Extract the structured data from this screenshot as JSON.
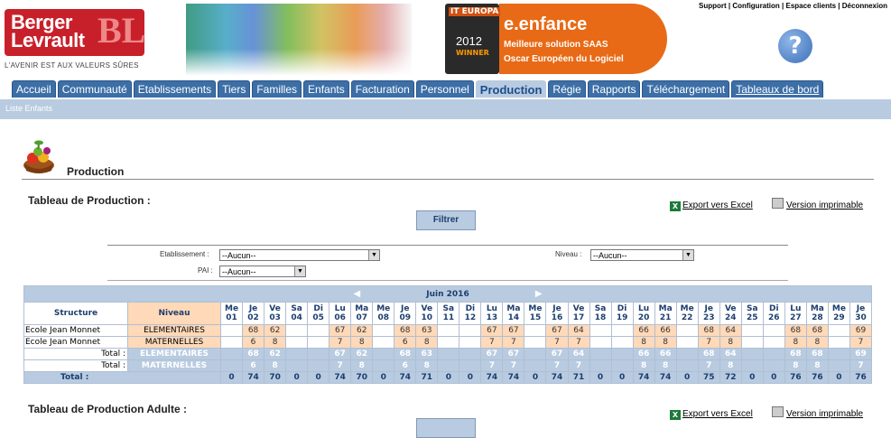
{
  "header": {
    "logo_line1": "Berger",
    "logo_line2": "Levrault",
    "logo_mark": "BL",
    "tagline": "L'AVENIR EST AUX VALEURS SÛRES",
    "award": {
      "badge": "IT EUROPA",
      "year": "2012",
      "winner": "WINNER",
      "title": "e.enfance",
      "line1": "Meilleure solution SAAS",
      "line2": "Oscar Européen du Logiciel"
    },
    "top_links": [
      "Support",
      "Configuration",
      "Espace clients",
      "Déconnexion"
    ],
    "help_glyph": "?"
  },
  "tabs": [
    {
      "label": "Accueil"
    },
    {
      "label": "Communauté"
    },
    {
      "label": "Etablissements"
    },
    {
      "label": "Tiers"
    },
    {
      "label": "Familles"
    },
    {
      "label": "Enfants"
    },
    {
      "label": "Facturation"
    },
    {
      "label": "Personnel"
    },
    {
      "label": "Production",
      "active": true
    },
    {
      "label": "Régie"
    },
    {
      "label": "Rapports"
    },
    {
      "label": "Téléchargement"
    },
    {
      "label": "Tableaux de bord"
    }
  ],
  "subnav": {
    "label": "Liste Enfants"
  },
  "page": {
    "title": "Production",
    "section_title": "Tableau de Production :",
    "section2_title": "Tableau de Production Adulte :",
    "export_excel": "Export vers Excel",
    "print_version": "Version imprimable",
    "filter_button": "Filtrer"
  },
  "filters": {
    "etablissement_label": "Etablissement :",
    "etablissement_value": "--Aucun--",
    "niveau_label": "Niveau :",
    "niveau_value": "--Aucun--",
    "pai_label": "PAI :",
    "pai_value": "--Aucun--"
  },
  "grid": {
    "month": "Juin 2016",
    "col_structure": "Structure",
    "col_niveau": "Niveau",
    "days": [
      [
        "Me",
        "01"
      ],
      [
        "Je",
        "02"
      ],
      [
        "Ve",
        "03"
      ],
      [
        "Sa",
        "04"
      ],
      [
        "Di",
        "05"
      ],
      [
        "Lu",
        "06"
      ],
      [
        "Ma",
        "07"
      ],
      [
        "Me",
        "08"
      ],
      [
        "Je",
        "09"
      ],
      [
        "Ve",
        "10"
      ],
      [
        "Sa",
        "11"
      ],
      [
        "Di",
        "12"
      ],
      [
        "Lu",
        "13"
      ],
      [
        "Ma",
        "14"
      ],
      [
        "Me",
        "15"
      ],
      [
        "Je",
        "16"
      ],
      [
        "Ve",
        "17"
      ],
      [
        "Sa",
        "18"
      ],
      [
        "Di",
        "19"
      ],
      [
        "Lu",
        "20"
      ],
      [
        "Ma",
        "21"
      ],
      [
        "Me",
        "22"
      ],
      [
        "Je",
        "23"
      ],
      [
        "Ve",
        "24"
      ],
      [
        "Sa",
        "25"
      ],
      [
        "Di",
        "26"
      ],
      [
        "Lu",
        "27"
      ],
      [
        "Ma",
        "28"
      ],
      [
        "Me",
        "29"
      ],
      [
        "Je",
        "30"
      ]
    ],
    "rows": [
      {
        "structure": "Ecole Jean Monnet",
        "niveau": "ELEMENTAIRES",
        "values": [
          "",
          "68",
          "62",
          "",
          "",
          "67",
          "62",
          "",
          "68",
          "63",
          "",
          "",
          "67",
          "67",
          "",
          "67",
          "64",
          "",
          "",
          "66",
          "66",
          "",
          "68",
          "64",
          "",
          "",
          "68",
          "68",
          "",
          "69"
        ]
      },
      {
        "structure": "Ecole Jean Monnet",
        "niveau": "MATERNELLES",
        "values": [
          "",
          "6",
          "8",
          "",
          "",
          "7",
          "8",
          "",
          "6",
          "8",
          "",
          "",
          "7",
          "7",
          "",
          "7",
          "7",
          "",
          "",
          "8",
          "8",
          "",
          "7",
          "8",
          "",
          "",
          "8",
          "8",
          "",
          "7"
        ]
      }
    ],
    "totals": [
      {
        "label": "Total :",
        "niveau": "ELEMENTAIRES",
        "values": [
          "",
          "68",
          "62",
          "",
          "",
          "67",
          "62",
          "",
          "68",
          "63",
          "",
          "",
          "67",
          "67",
          "",
          "67",
          "64",
          "",
          "",
          "66",
          "66",
          "",
          "68",
          "64",
          "",
          "",
          "68",
          "68",
          "",
          "69"
        ]
      },
      {
        "label": "Total :",
        "niveau": "MATERNELLES",
        "values": [
          "",
          "6",
          "8",
          "",
          "",
          "7",
          "8",
          "",
          "6",
          "8",
          "",
          "",
          "7",
          "7",
          "",
          "7",
          "7",
          "",
          "",
          "8",
          "8",
          "",
          "7",
          "8",
          "",
          "",
          "8",
          "8",
          "",
          "7"
        ]
      }
    ],
    "grand_total": {
      "label": "Total :",
      "values": [
        "0",
        "74",
        "70",
        "0",
        "0",
        "74",
        "70",
        "0",
        "74",
        "71",
        "0",
        "0",
        "74",
        "74",
        "0",
        "74",
        "71",
        "0",
        "0",
        "74",
        "74",
        "0",
        "75",
        "72",
        "0",
        "0",
        "76",
        "76",
        "0",
        "76"
      ]
    }
  }
}
